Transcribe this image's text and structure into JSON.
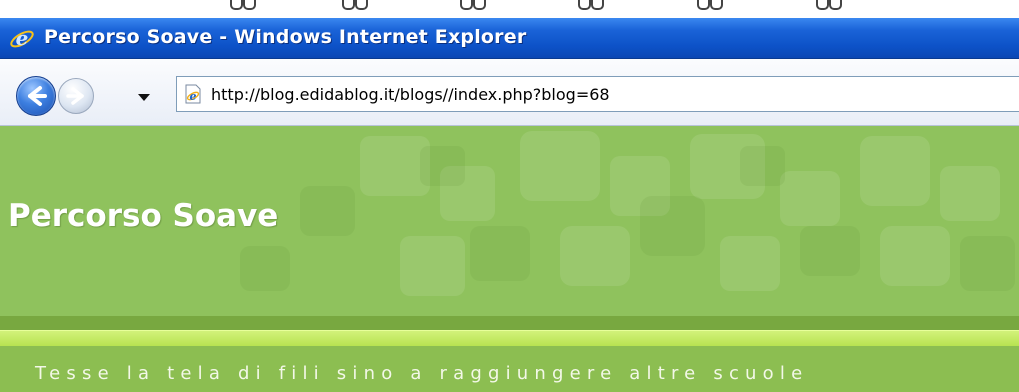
{
  "window": {
    "title": "Percorso Soave - Windows Internet Explorer",
    "app_icon": "ie-logo-icon",
    "accent_color": "#0d52c8"
  },
  "navigation": {
    "back_icon": "back-arrow-icon",
    "forward_icon": "forward-arrow-icon",
    "history_icon": "chevron-down-icon",
    "address": {
      "page_icon": "ie-page-icon",
      "url": "http://blog.edidablog.it/blogs//index.php?blog=68"
    }
  },
  "page": {
    "title": "Percorso Soave",
    "tagline": "Tesse la tela di fili sino a raggiungere altre scuole",
    "colors": {
      "header_green": "#8fc25d",
      "band_dark": "#78a840",
      "band_light": "#c6ec64"
    }
  }
}
